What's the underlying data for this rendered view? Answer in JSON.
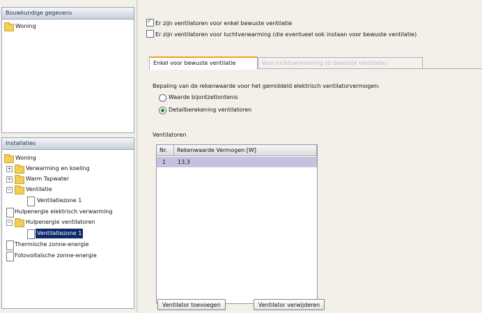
{
  "left_top_panel": {
    "header": "Bouwkundige gegevens",
    "items": [
      {
        "label": "Woning"
      }
    ]
  },
  "left_bottom_panel": {
    "header": "Installaties",
    "items": [
      {
        "label": "Woning"
      },
      {
        "label": "Verwarming en koeling"
      },
      {
        "label": "Warm Tapwater"
      },
      {
        "label": "Ventilatie"
      },
      {
        "label": "Ventilatiezone 1"
      },
      {
        "label": "Hulpenergie elektrisch verwarming"
      },
      {
        "label": "Hulpenergie ventilatoren"
      },
      {
        "label": "Ventilatiezone 1"
      },
      {
        "label": "Thermische zonne-energie"
      },
      {
        "label": "Fotovoltaïsche zonne-energie"
      }
    ]
  },
  "checks": {
    "check1_label": "Er zijn ventilatoren voor enkel bewuste ventilatie",
    "check2_label": "Er zijn ventilatoren voor luchtverwarming (die eventueel ook instaan voor bewuste ventilatie)"
  },
  "tabs": [
    {
      "label": "Enkel voor bewuste ventilatie"
    },
    {
      "label": "Voor luchtverwarming (& bewuste ventilatie)"
    }
  ],
  "form": {
    "intro": "Bepaling van de rekenwaarde voor het gemiddeld elektrisch ventilatorvermogen:",
    "radio1_label": "Waarde bijontzetlontenis",
    "radio2_label": "Detailberekening ventilatoren",
    "section_label": "Ventilatoren"
  },
  "table": {
    "headers": [
      "Nr.",
      "Rekenwaarde Vermogen [W]"
    ],
    "rows": [
      {
        "nr": "1",
        "value": "13,3"
      }
    ]
  },
  "buttons": {
    "add": "Ventilator toevoegen",
    "remove": "Ventilator verwijderen"
  },
  "colors": {
    "selection": "#0b2a6b",
    "tab_accent": "#f0a020",
    "check_mark": "#1a8a1a"
  }
}
